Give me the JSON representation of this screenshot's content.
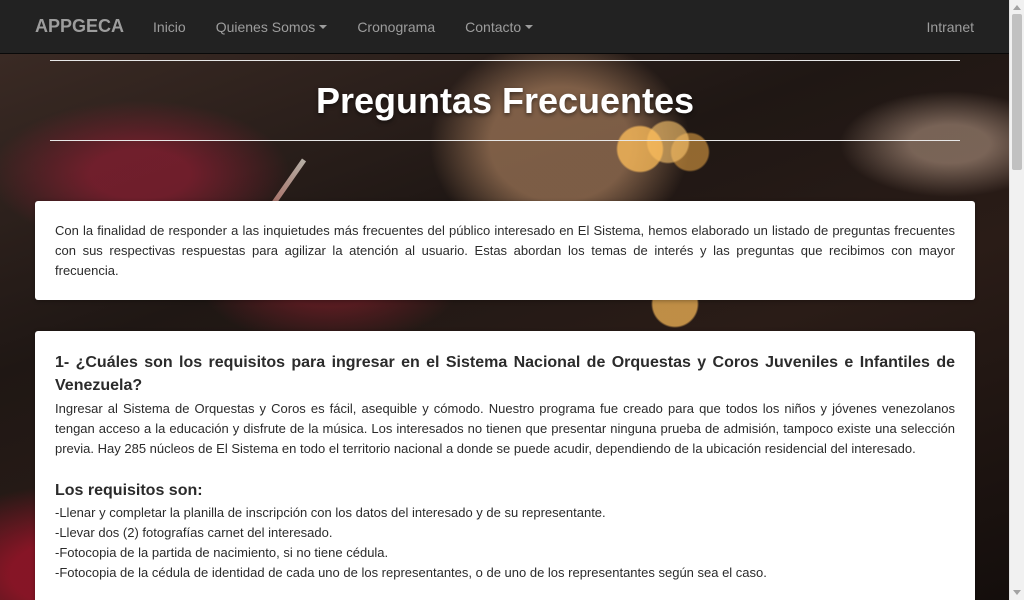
{
  "navbar": {
    "brand": "APPGECA",
    "items": [
      {
        "label": "Inicio",
        "dropdown": false
      },
      {
        "label": "Quienes Somos",
        "dropdown": true
      },
      {
        "label": "Cronograma",
        "dropdown": false
      },
      {
        "label": "Contacto",
        "dropdown": true
      }
    ],
    "right_item": "Intranet"
  },
  "header": {
    "title": "Preguntas Frecuentes"
  },
  "intro": {
    "text": "Con la finalidad de responder a las inquietudes más frecuentes del público interesado en El Sistema, hemos elaborado un listado de preguntas frecuentes con sus respectivas respuestas para agilizar la atención al usuario. Estas abordan los temas de interés y las preguntas que recibimos con mayor frecuencia."
  },
  "faq": {
    "question": "1- ¿Cuáles son los requisitos para ingresar en el Sistema Nacional de Orquestas y Coros Juveniles e Infantiles de Venezuela?",
    "answer": "Ingresar al Sistema de Orquestas y Coros es fácil, asequible y cómodo. Nuestro programa fue creado para que todos los niños y jóvenes venezolanos tengan acceso a la educación y disfrute de la música. Los interesados no tienen que presentar ninguna prueba de admisión, tampoco existe una selección previa. Hay 285 núcleos de El Sistema en todo el territorio nacional a donde se puede acudir, dependiendo de la ubicación residencial del interesado.",
    "requirements_heading": "Los requisitos son:",
    "requirements": [
      "-Llenar y completar la planilla de inscripción con los datos del interesado y de su representante.",
      "-Llevar dos (2) fotografías carnet del interesado.",
      "-Fotocopia de la partida de nacimiento, si no tiene cédula.",
      "-Fotocopia de la cédula de identidad de cada uno de los representantes, o de uno de los representantes según sea el caso."
    ]
  },
  "colors": {
    "navbar_bg": "#222222",
    "nav_text": "#9d9d9d",
    "title_text": "#ffffff",
    "panel_bg": "#ffffff"
  }
}
